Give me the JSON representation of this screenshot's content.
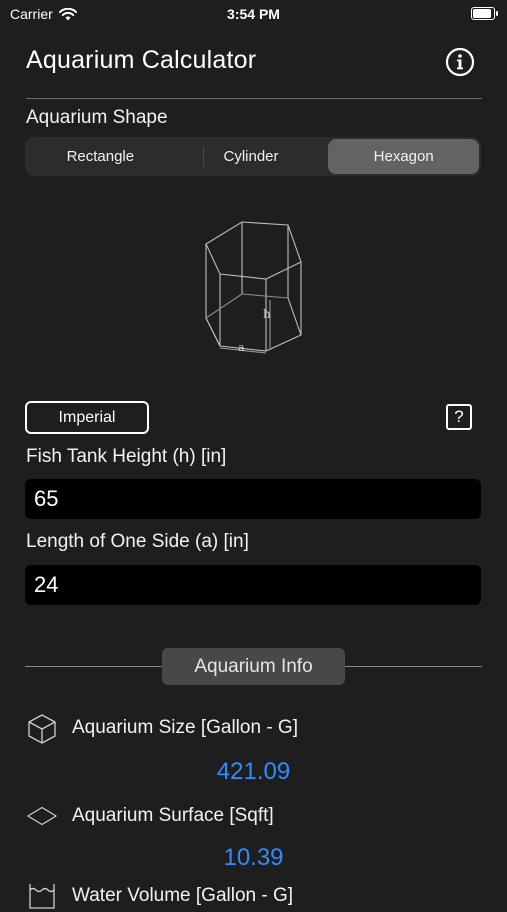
{
  "status": {
    "carrier": "Carrier",
    "time": "3:54 PM",
    "battery_level": 1.0
  },
  "header": {
    "title": "Aquarium Calculator"
  },
  "shape": {
    "label": "Aquarium Shape",
    "options": [
      "Rectangle",
      "Cylinder",
      "Hexagon"
    ],
    "selected": "Hexagon"
  },
  "diagram": {
    "height_symbol": "h",
    "side_symbol": "a"
  },
  "units": {
    "button_label": "Imperial",
    "help_label": "?"
  },
  "fields": [
    {
      "label": "Fish Tank Height (h) [in]",
      "value": "65"
    },
    {
      "label": "Length of One Side (a) [in]",
      "value": "24"
    }
  ],
  "info": {
    "section_title": "Aquarium Info",
    "rows": [
      {
        "icon": "cube-icon",
        "label": "Aquarium Size [Gallon - G]",
        "value": "421.09"
      },
      {
        "icon": "surface-icon",
        "label": "Aquarium Surface [Sqft]",
        "value": "10.39"
      },
      {
        "icon": "water-volume-icon",
        "label": "Water Volume [Gallon - G]",
        "value": ""
      }
    ]
  },
  "colors": {
    "accent": "#2f8cff",
    "background": "#1e1e1e",
    "input_bg": "#000000",
    "segment_selected": "#636366"
  }
}
